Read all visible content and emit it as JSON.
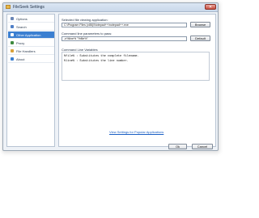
{
  "window": {
    "title": "FileSeek Settings",
    "close_glyph": "✕"
  },
  "sidebar": {
    "items": [
      {
        "label": "Options",
        "icon": "options-icon",
        "color": "#6a86b6"
      },
      {
        "label": "Search",
        "icon": "search-icon",
        "color": "#4f7fc7"
      },
      {
        "label": "Other Application",
        "icon": "application-icon",
        "color": "#ffffff"
      },
      {
        "label": "Proxy",
        "icon": "proxy-icon",
        "color": "#3e8a3e"
      },
      {
        "label": "File Handlers",
        "icon": "file-handlers-icon",
        "color": "#d9a23a"
      },
      {
        "label": "About",
        "icon": "about-icon",
        "color": "#3b7fd1"
      }
    ],
    "active_index": 2,
    "active_color": "#3b7fd1"
  },
  "main": {
    "file_label": "Selected file viewing application:",
    "file_value": "C:\\Program Files (x86)\\Notepad++\\notepad++.exe",
    "browse_label": "Browse",
    "params_label": "Command line parameters to pass:",
    "params_value": "-n%line% \"%file%\"",
    "default_label": "Default",
    "vars_label": "Command Line Variables",
    "vars_lines": [
      "%file%  : Substitutes the complete filename.",
      "%line%  : Substitutes the line number."
    ],
    "link_text": "View Settings for Popular Applications"
  },
  "footer": {
    "ok_label": "Ok",
    "cancel_label": "Cancel"
  }
}
